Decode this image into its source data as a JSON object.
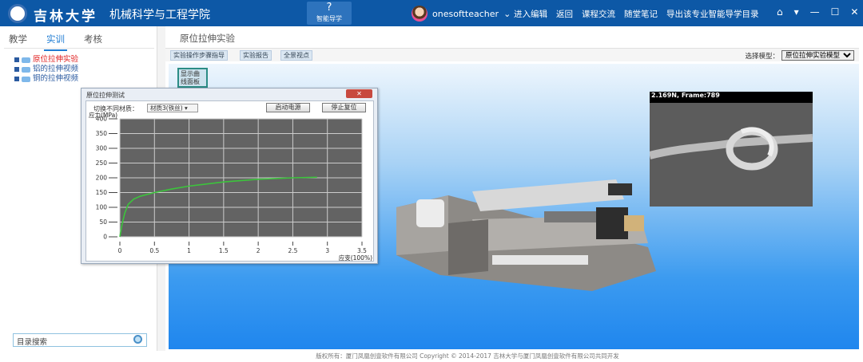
{
  "header": {
    "school": "吉林大学",
    "college": "机械科学与工程学院",
    "guide_label": "智能导学",
    "user": "onesoftteacher",
    "nav": [
      "进入编辑",
      "返回",
      "课程交流",
      "随堂笔记",
      "导出该专业智能导学目录"
    ]
  },
  "left": {
    "tabs": [
      "教学",
      "实训",
      "考核"
    ],
    "active_tab": 1,
    "tree": [
      "原位拉伸实验",
      "铝的拉伸视频",
      "铜的拉伸视频"
    ],
    "search_placeholder": "目录搜索"
  },
  "main": {
    "tab": "原位拉伸实验",
    "toolbar": [
      "实验操作步骤指导",
      "实验报告",
      "全景视点"
    ],
    "model_label": "选择模型：",
    "model_value": "原位拉伸实验模型",
    "show_curve": "显示曲线面板"
  },
  "dialog": {
    "title": "原位拉伸测试",
    "switch_label": "切换不同材质：",
    "material": "材质3(铁丝)",
    "start": "启动电源",
    "stop": "停止复位"
  },
  "photo": {
    "overlay": "2.169N, Frame:789"
  },
  "footer": "版权所有：厦门凤凰创壹软件有限公司   Copyright © 2014-2017      吉林大学与厦门凤凰创壹软件有限公司共同开发",
  "colors": {
    "header": "#0d58a6",
    "accent": "#1d7bd2",
    "curve": "#3cc43c"
  },
  "chart_data": {
    "type": "line",
    "xlabel": "应变(100%)",
    "ylabel": "应力(MPa)",
    "xlim": [
      0,
      3.5
    ],
    "ylim": [
      0,
      400
    ],
    "xticks": [
      "0",
      "0.5",
      "1",
      "1.5",
      "2",
      "2.5",
      "3",
      "3.5"
    ],
    "yticks": [
      "0",
      "50",
      "100",
      "150",
      "200",
      "250",
      "300",
      "350",
      "400"
    ],
    "series": [
      {
        "name": "材质3(铁丝)",
        "x": [
          0,
          0.03,
          0.07,
          0.12,
          0.2,
          0.3,
          0.5,
          0.75,
          1,
          1.5,
          2,
          2.5,
          2.85
        ],
        "y": [
          0,
          40,
          80,
          110,
          128,
          138,
          150,
          162,
          172,
          186,
          195,
          200,
          202
        ]
      }
    ]
  }
}
